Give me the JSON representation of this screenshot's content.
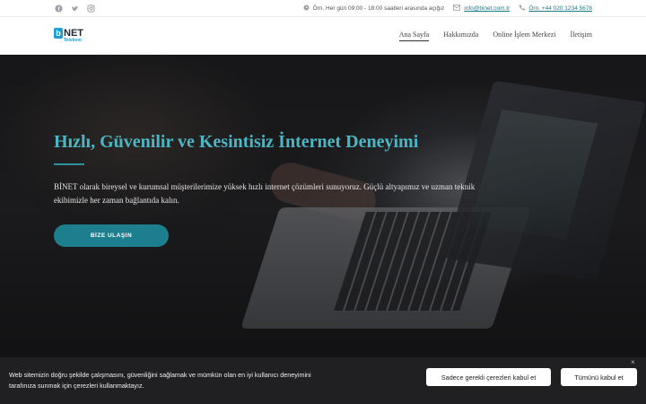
{
  "topbar": {
    "social": [
      {
        "icon": "facebook-icon"
      },
      {
        "icon": "twitter-icon"
      },
      {
        "icon": "instagram-icon"
      }
    ],
    "hours": "Örn. Her gün 09:00 - 18:00 saatleri arasında açığız",
    "email": "info@binet.com.tr",
    "phone": "Örn. +44 020 1234 5678"
  },
  "logo": {
    "brand": "NET",
    "letter": "b",
    "sub": "Telekom"
  },
  "nav": {
    "items": [
      {
        "label": "Ana Sayfa",
        "active": true
      },
      {
        "label": "Hakkımızda"
      },
      {
        "label": "Online İşlem Merkezi"
      },
      {
        "label": "İletişim"
      }
    ]
  },
  "hero": {
    "title": "Hızlı, Güvenilir ve Kesintisiz İnternet Deneyimi",
    "text": "BİNET olarak bireysel ve kurumsal müşterilerimize yüksek hızlı internet çözümleri sunuyoruz. Güçlü altyapımız ve uzman teknik ekibimizle her zaman bağlantıda kalın.",
    "button": "BİZE ULAŞIN"
  },
  "cookie": {
    "text": "Web sitemizin doğru şekilde çalışmasını, güvenliğini sağlamak ve mümkün olan en iyi kullanıcı deneyimini tarafınıza sunmak için çerezleri kullanmaktayız.",
    "btn_necessary": "Sadece gerekli çerezleri kabul et",
    "btn_all": "Tümünü kabul et",
    "close": "×"
  },
  "colors": {
    "accent": "#1d7f8d",
    "title": "#4bb6c4",
    "cookie_bg": "#202022"
  }
}
